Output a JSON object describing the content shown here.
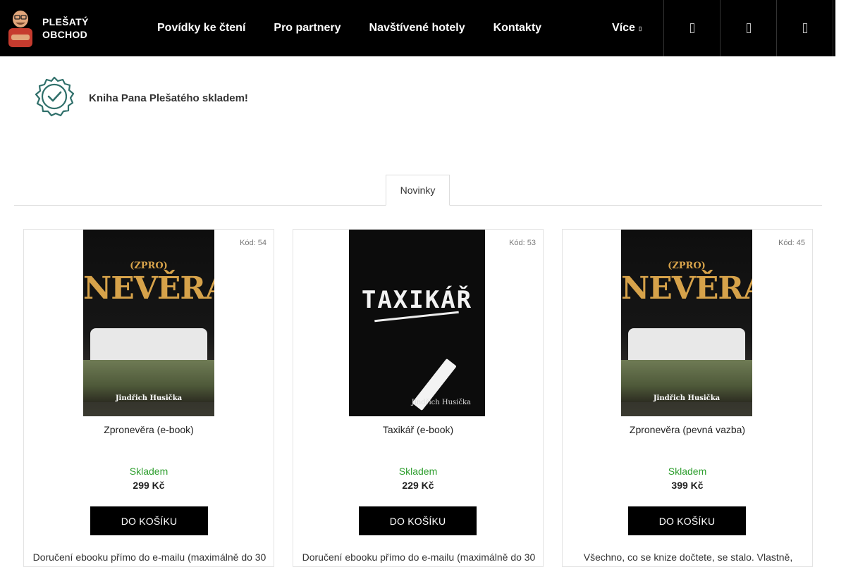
{
  "header": {
    "logo_text_line1": "PLEŠATÝ",
    "logo_text_line2": "OBCHOD",
    "nav": [
      "Povídky ke čtení",
      "Pro partnery",
      "Navštívené hotely",
      "Kontakty"
    ],
    "more_label": "Více",
    "icons": [
      "search-icon",
      "user-icon",
      "cart-icon"
    ]
  },
  "banner": {
    "text": "Kniha Pana Plešatého skladem!"
  },
  "tabs": {
    "active_label": "Novinky"
  },
  "products": [
    {
      "code": "Kód: 54",
      "name": "Zpronevěra (e-book)",
      "stock": "Skladem",
      "price": "299 Kč",
      "button": "DO KOŠÍKU",
      "description": "Doručení ebooku přímo do e-mailu (maximálně do 30",
      "cover": {
        "sub": "(ZPRO)",
        "title": "NEVĚRA",
        "author": "Jindřich Husička"
      }
    },
    {
      "code": "Kód: 53",
      "name": "Taxikář (e-book)",
      "stock": "Skladem",
      "price": "229 Kč",
      "button": "DO KOŠÍKU",
      "description": "Doručení ebooku přímo do e-mailu (maximálně do 30",
      "cover": {
        "title": "TAXIKÁŘ",
        "author": "Jindřich Husička"
      }
    },
    {
      "code": "Kód: 45",
      "name": "Zpronevěra (pevná vazba)",
      "stock": "Skladem",
      "price": "399 Kč",
      "button": "DO KOŠÍKU",
      "description": "Všechno, co se knize dočtete, se stalo. Vlastně,",
      "cover": {
        "sub": "(ZPRO)",
        "title": "NEVĚRA",
        "author": "Jindřich Husička"
      }
    }
  ],
  "colors": {
    "header_bg": "#000000",
    "stock_green": "#2e9e2e",
    "gold": "#d6a24a",
    "badge_teal": "#2f6f6a"
  }
}
